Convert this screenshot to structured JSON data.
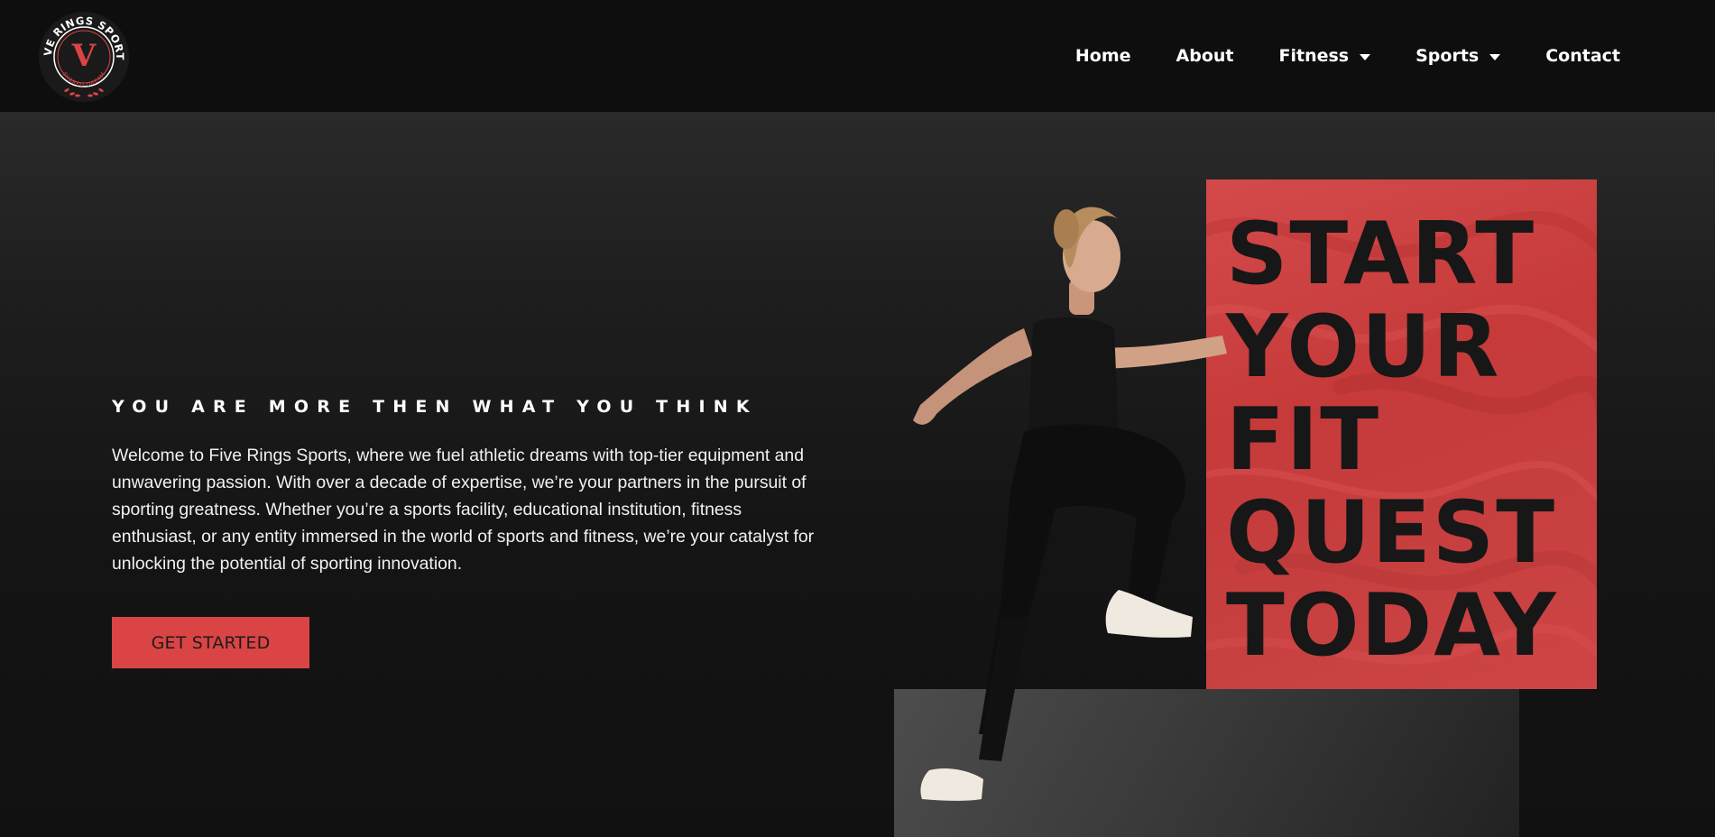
{
  "brand": {
    "logo_text_top": "FIVE RINGS SPORTS",
    "logo_text_bottom": "SHARED DREAM",
    "logo_letter": "V",
    "accent_color": "#da4444"
  },
  "nav": {
    "items": [
      {
        "label": "Home",
        "has_dropdown": false
      },
      {
        "label": "About",
        "has_dropdown": false
      },
      {
        "label": "Fitness",
        "has_dropdown": true
      },
      {
        "label": "Sports",
        "has_dropdown": true
      },
      {
        "label": "Contact",
        "has_dropdown": false
      }
    ]
  },
  "hero": {
    "tagline": "YOU ARE MORE THEN WHAT YOU THINK",
    "intro": "Welcome to Five Rings Sports, where we fuel athletic dreams with top-tier equipment and unwavering passion. With over a decade of expertise, we’re your partners in the pursuit of sporting greatness. Whether you’re a sports facility, educational institution, fitness enthusiast, or any entity immersed in the world of sports and fitness, we’re your catalyst for unlocking the potential of sporting innovation.",
    "cta_label": "GET STARTED",
    "headline_lines": [
      "START",
      "YOUR",
      "FIT",
      "QUEST",
      "TODAY"
    ]
  }
}
